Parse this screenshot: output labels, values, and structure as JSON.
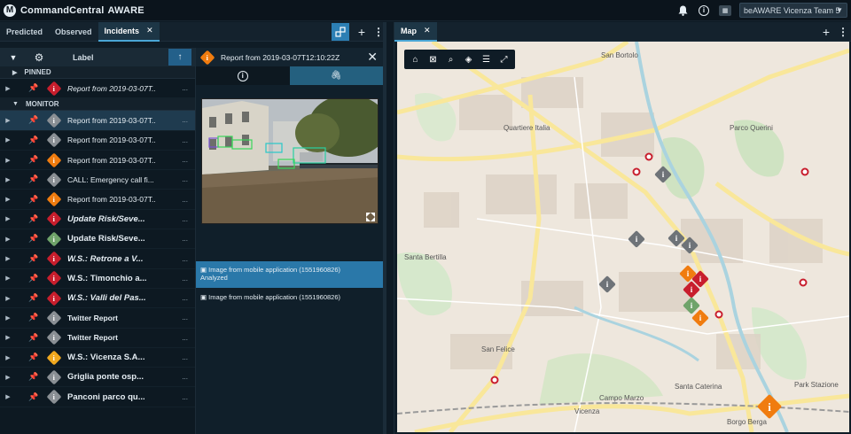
{
  "app": {
    "name": "CommandCentral",
    "product": "AWARE",
    "team_select": "beAWARE Vicenza Team 5"
  },
  "left_tabs": [
    {
      "label": "Predicted"
    },
    {
      "label": "Observed"
    },
    {
      "label": "Incidents"
    }
  ],
  "list_header": {
    "label": "Label"
  },
  "groups": {
    "pinned": "PINNED",
    "monitor": "MONITOR"
  },
  "pinned_item": {
    "text": "Report from 2019-03-07T...",
    "icon_color": "#c81e2d"
  },
  "items": [
    {
      "text": "Report from 2019-03-07T...",
      "color": "#8a8f94",
      "style": "",
      "pin": false,
      "selected": true
    },
    {
      "text": "Report from 2019-03-07T...",
      "color": "#8a8f94",
      "style": "",
      "pin": false
    },
    {
      "text": "Report from 2019-03-07T...",
      "color": "#f07c0f",
      "style": "",
      "pin": false
    },
    {
      "text": "CALL: Emergency call fi...",
      "color": "#8a8f94",
      "style": "",
      "pin": false
    },
    {
      "text": "Report from 2019-03-07T...",
      "color": "#f07c0f",
      "style": "",
      "pin": false
    },
    {
      "text": "Update Risk/Seve...",
      "color": "#c81e2d",
      "style": "bold it",
      "pin": false
    },
    {
      "text": "Update Risk/Seve...",
      "color": "#6fa36a",
      "style": "bold",
      "pin": false
    },
    {
      "text": "W.S.: Retrone a V...",
      "color": "#c81e2d",
      "style": "bold it",
      "pin": false
    },
    {
      "text": "W.S.: Timonchio a...",
      "color": "#c81e2d",
      "style": "bold",
      "pin": false
    },
    {
      "text": "W.S.: Valli del Pas...",
      "color": "#c81e2d",
      "style": "bold it",
      "pin": false
    },
    {
      "text": "Twitter Report",
      "color": "#8a8f94",
      "style": "bold small",
      "pin": false
    },
    {
      "text": "Twitter Report",
      "color": "#8a8f94",
      "style": "bold small",
      "pin": false
    },
    {
      "text": "W.S.: Vicenza S.A...",
      "color": "#f0a81e",
      "style": "bold",
      "pin": false
    },
    {
      "text": "Griglia ponte osp...",
      "color": "#8a8f94",
      "style": "bold",
      "pin": false
    },
    {
      "text": "Panconi parco qu...",
      "color": "#8a8f94",
      "style": "bold",
      "pin": false
    }
  ],
  "more_label": "...",
  "detail": {
    "title": "Report from 2019-03-07T12:10:22Z",
    "icon_color": "#f07c0f"
  },
  "attachments": [
    {
      "line1": "Image from mobile application (1551960826)",
      "line2": "Analyzed"
    },
    {
      "line1": "Image from mobile application (1551960826)",
      "line2": ""
    }
  ],
  "map_tab": {
    "label": "Map"
  },
  "map_labels": {
    "quartiere_italia": "Quartiere Italia",
    "san_bortolo": "San Bortolo",
    "san_felice": "San Felice",
    "santa_bertilla": "Santa Bertilla",
    "campo_marzo": "Campo Marzo",
    "santa_caterina": "Santa Caterina",
    "borgo_berga": "Borgo Berga",
    "vicenza": "Vicenza",
    "parco_querini": "Parco Querini",
    "park_station": "Park Stazione"
  }
}
